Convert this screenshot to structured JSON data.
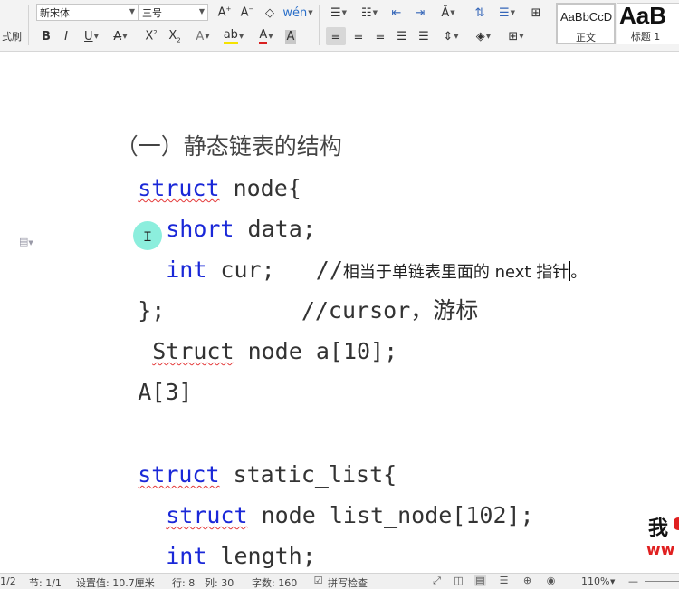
{
  "toolbar": {
    "format_painter_label": "式刷",
    "font_name": "新宋体",
    "font_size": "三号",
    "styles": [
      {
        "preview": "AaBbCcD",
        "label": "正文"
      },
      {
        "preview": "AaB",
        "label": "标题 1"
      }
    ],
    "icons": [
      "grow-font-icon",
      "shrink-font-icon",
      "clear-format-icon",
      "phonetic-guide-icon",
      "bullets-icon",
      "numbering-icon",
      "decrease-indent-icon",
      "increase-indent-icon",
      "change-case-icon",
      "sort-icon",
      "line-spacing-icon",
      "table-icon",
      "bold-icon",
      "italic-icon",
      "underline-icon",
      "strikethrough-icon",
      "superscript-icon",
      "subscript-icon",
      "text-effect-icon",
      "highlight-icon",
      "font-color-icon",
      "char-shading-icon",
      "align-left-icon",
      "align-center-icon",
      "align-right-icon",
      "justify-icon",
      "distributed-icon",
      "paragraph-spacing-icon",
      "shading-icon",
      "borders-icon"
    ]
  },
  "document": {
    "heading": "（一）静态链表的结构",
    "lines": [
      {
        "kw": "struct",
        "rest": " node{"
      },
      {
        "kw": "short",
        "rest": " data;"
      },
      {
        "kw": "int",
        "rest": " cur;   //",
        "comment": "相当于单链表里面的 next 指针",
        "tail": "。"
      },
      {
        "text": "};          //cursor，游标"
      },
      {
        "sq": "Struct",
        "rest": " node a[10];"
      },
      {
        "text": "A[3]"
      },
      {
        "kw": "struct",
        "rest": " static_list{"
      },
      {
        "kw": "struct",
        "rest": " node list_node[102];"
      },
      {
        "kw": "int",
        "rest": " length;"
      },
      {
        "text": "};"
      }
    ],
    "watermark": {
      "line1": "我",
      "line2": "ww"
    }
  },
  "status": {
    "page": "1/2",
    "section": "节: 1/1",
    "setting": "设置值: 10.7厘米",
    "row": "行: 8",
    "col": "列: 30",
    "word_count": "字数: 160",
    "spell_check": "拼写检查",
    "zoom": "110%",
    "zoom_out": "—"
  },
  "colors": {
    "keyword": "#1a28d8",
    "spell_error": "#e43a3a",
    "cursor_highlight": "#78ebd7"
  }
}
